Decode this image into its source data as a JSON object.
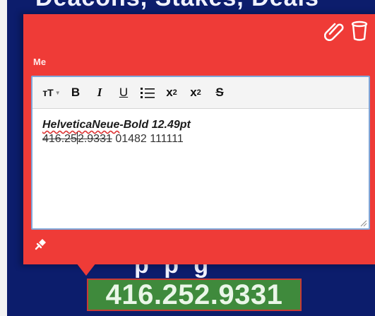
{
  "background": {
    "top_text": "Deacons, Stakes, Deals",
    "bottom_text": "p p g",
    "phone_highlight": "416.252.9331",
    "colors": {
      "document_bg": "#0c1d6c",
      "highlight_bg": "#3f8a3c",
      "highlight_border": "#c83a34"
    }
  },
  "note": {
    "color": "#ef3b37",
    "author": "Me",
    "actions": {
      "attach_icon": "paperclip-icon",
      "delete_icon": "trash-icon"
    },
    "toolbar": {
      "text_size": "тT",
      "bold": "B",
      "italic": "I",
      "underline": "U",
      "list": "☰",
      "subscript_base": "x",
      "subscript_mark": "2",
      "superscript_base": "x",
      "superscript_mark": "2",
      "strike": "S"
    },
    "content": {
      "font_label": "HelveticaNeue-Bold 12.49pt",
      "font_name": "HelveticaNeue",
      "font_rest": "-Bold 12.49pt",
      "old_phone_part1": "416.25",
      "old_phone_part2": "2.9331",
      "new_text": " 01482 111111"
    },
    "pin_icon": "pin-icon"
  }
}
